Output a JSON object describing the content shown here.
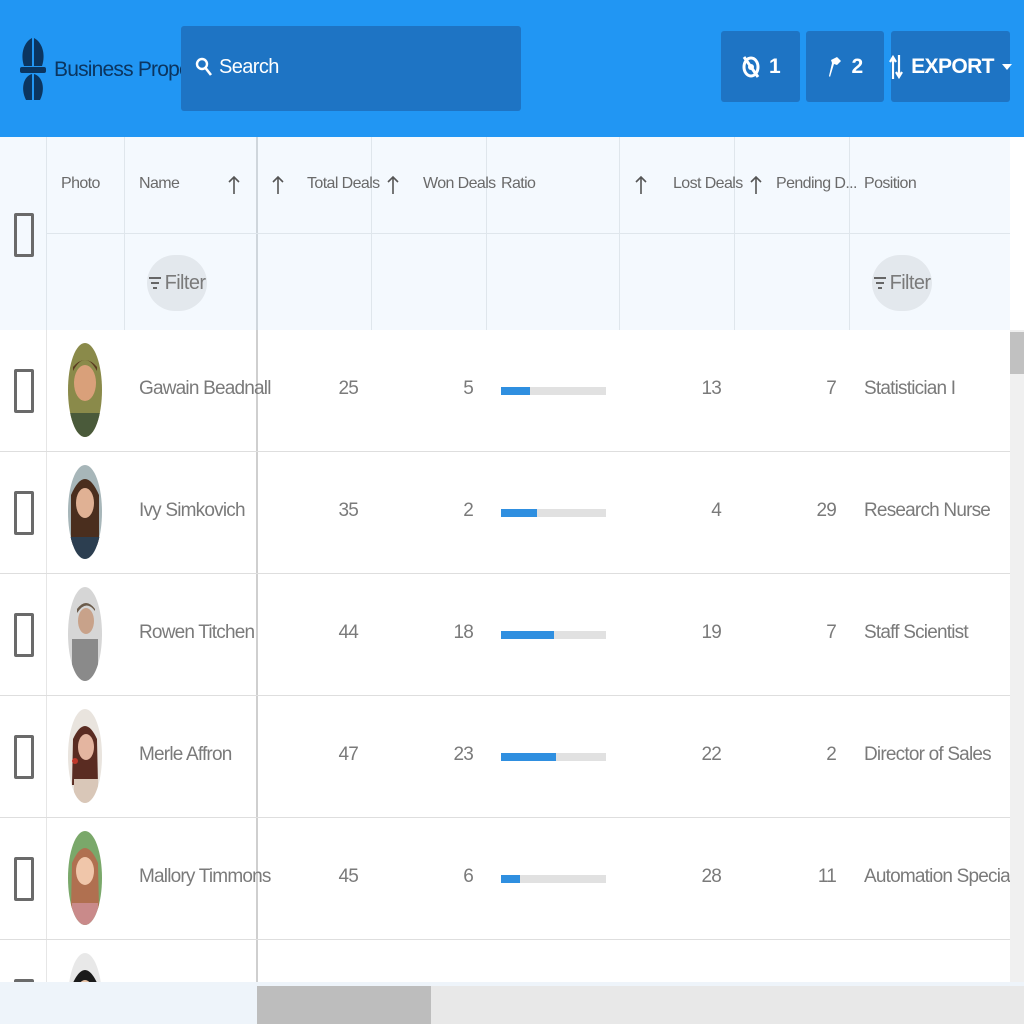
{
  "app": {
    "brand": "Business Propeller",
    "search_placeholder": "Search",
    "buttons": [
      {
        "icon": "hidden-icon",
        "label": "1"
      },
      {
        "icon": "pin-icon",
        "label": "2"
      },
      {
        "icon": "sort-export-icon",
        "label": "EXPORT",
        "dropdown": true
      }
    ],
    "accent": "#2196f3"
  },
  "grid": {
    "headers": {
      "photo": "Photo",
      "name": "Name",
      "total_deals": "Total Deals",
      "won_deals": "Won Deals",
      "ratio": "Ratio",
      "lost_deals": "Lost Deals",
      "pending_deals": "Pending D...",
      "position": "Position"
    },
    "filter_label": "Filter",
    "rows": [
      {
        "name": "Gawain Beadnall",
        "total": "25",
        "won": "5",
        "ratio": 0.28,
        "lost": "13",
        "pending": "7",
        "position": "Statistician I"
      },
      {
        "name": "Ivy Simkovich",
        "total": "35",
        "won": "2",
        "ratio": 0.34,
        "lost": "4",
        "pending": "29",
        "position": "Research Nurse"
      },
      {
        "name": "Rowen Titchen",
        "total": "44",
        "won": "18",
        "ratio": 0.5,
        "lost": "19",
        "pending": "7",
        "position": "Staff Scientist"
      },
      {
        "name": "Merle Affron",
        "total": "47",
        "won": "23",
        "ratio": 0.52,
        "lost": "22",
        "pending": "2",
        "position": "Director of Sales"
      },
      {
        "name": "Mallory Timmons",
        "total": "45",
        "won": "6",
        "ratio": 0.18,
        "lost": "28",
        "pending": "11",
        "position": "Automation Specialist IV"
      }
    ]
  }
}
